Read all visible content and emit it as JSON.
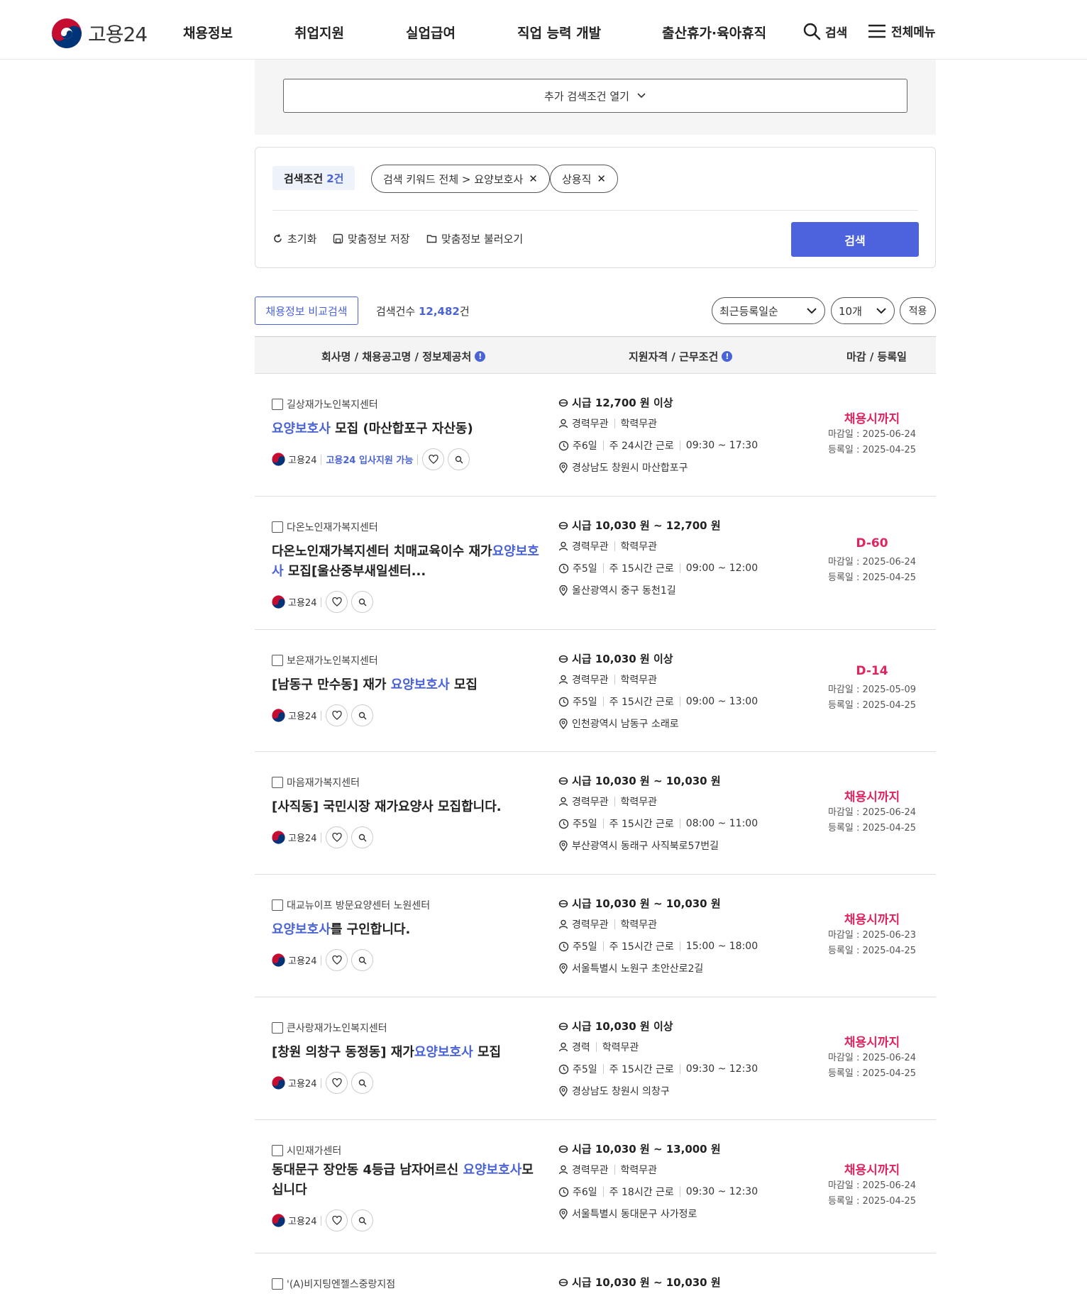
{
  "header": {
    "logo_text": "고용24",
    "nav": [
      "채용정보",
      "취업지원",
      "실업급여",
      "직업 능력 개발",
      "출산휴가·육아휴직"
    ],
    "search_label": "검색",
    "menu_label": "전체메뉴"
  },
  "options": {
    "more_conditions": "추가 검색조건 열기"
  },
  "conditions": {
    "label": "검색조건",
    "count": "2건",
    "chips": [
      "검색 키워드 전체 > 요양보호사",
      "상용직"
    ],
    "reset": "초기화",
    "save": "맞춤정보 저장",
    "load": "맞춤정보 불러오기",
    "search_button": "검색"
  },
  "toolbar": {
    "compare_button": "채용정보 비교검색",
    "total_label": "검색건수",
    "total_count": "12,482",
    "total_unit": "건",
    "sort_value": "최근등록일순",
    "size_value": "10개",
    "apply": "적용"
  },
  "table_header": {
    "col1": "회사명 / 채용공고명 / 정보제공처",
    "col2": "지원자격 / 근무조건",
    "col3": "마감 / 등록일"
  },
  "source_label": "고용24",
  "jobs": [
    {
      "company": "길상재가노인복지센터",
      "title_parts": [
        [
          "요양보호사",
          true
        ],
        [
          " 모집 (마산합포구 자산동)",
          false
        ]
      ],
      "apply_tag": "고용24 입사지원 가능",
      "wage": "시급 12,700 원 이상",
      "career": "경력무관",
      "edu": "학력무관",
      "days": "주6일",
      "hours": "주 24시간 근로",
      "time": "09:30 ~ 17:30",
      "location": "경상남도 창원시 마산합포구",
      "status": "채용시까지",
      "deadline": "마감일 : 2025-06-24",
      "registered": "등록일 : 2025-04-25"
    },
    {
      "company": "다온노인재가복지센터",
      "title_parts": [
        [
          "다온노인재가복지센터 치매교육이수 재가",
          false
        ],
        [
          "요양보호사",
          true
        ],
        [
          " 모집[울산중부새일센터...",
          false
        ]
      ],
      "apply_tag": "",
      "wage": "시급 10,030 원 ~ 12,700 원",
      "career": "경력무관",
      "edu": "학력무관",
      "days": "주5일",
      "hours": "주 15시간 근로",
      "time": "09:00 ~ 12:00",
      "location": "울산광역시 중구 동천1길",
      "status": "D-60",
      "deadline": "마감일 : 2025-06-24",
      "registered": "등록일 : 2025-04-25"
    },
    {
      "company": "보은재가노인복지센터",
      "title_parts": [
        [
          "[남동구 만수동] 재가 ",
          false
        ],
        [
          "요양보호사",
          true
        ],
        [
          " 모집",
          false
        ]
      ],
      "apply_tag": "",
      "wage": "시급 10,030 원 이상",
      "career": "경력무관",
      "edu": "학력무관",
      "days": "주5일",
      "hours": "주 15시간 근로",
      "time": "09:00 ~ 13:00",
      "location": "인천광역시 남동구 소래로",
      "status": "D-14",
      "deadline": "마감일 : 2025-05-09",
      "registered": "등록일 : 2025-04-25"
    },
    {
      "company": "마음재가복지센터",
      "title_parts": [
        [
          "[사직동] 국민시장 재가요양사 모집합니다.",
          false
        ]
      ],
      "apply_tag": "",
      "wage": "시급 10,030 원 ~ 10,030 원",
      "career": "경력무관",
      "edu": "학력무관",
      "days": "주5일",
      "hours": "주 15시간 근로",
      "time": "08:00 ~ 11:00",
      "location": "부산광역시 동래구 사직북로57번길",
      "status": "채용시까지",
      "deadline": "마감일 : 2025-06-24",
      "registered": "등록일 : 2025-04-25"
    },
    {
      "company": "대교뉴이프 방문요양센터 노원센터",
      "title_parts": [
        [
          "요양보호사",
          true
        ],
        [
          "를 구인합니다.",
          false
        ]
      ],
      "apply_tag": "",
      "wage": "시급 10,030 원 ~ 10,030 원",
      "career": "경력무관",
      "edu": "학력무관",
      "days": "주5일",
      "hours": "주 15시간 근로",
      "time": "15:00 ~ 18:00",
      "location": "서울특별시 노원구 초안산로2길",
      "status": "채용시까지",
      "deadline": "마감일 : 2025-06-23",
      "registered": "등록일 : 2025-04-25"
    },
    {
      "company": "큰사랑재가노인복지센터",
      "title_parts": [
        [
          "[창원 의창구 동정동] 재가",
          false
        ],
        [
          "요양보호사",
          true
        ],
        [
          " 모집",
          false
        ]
      ],
      "apply_tag": "",
      "wage": "시급 10,030 원 이상",
      "career": "경력",
      "edu": "학력무관",
      "days": "주5일",
      "hours": "주 15시간 근로",
      "time": "09:30 ~ 12:30",
      "location": "경상남도 창원시 의창구",
      "status": "채용시까지",
      "deadline": "마감일 : 2025-06-24",
      "registered": "등록일 : 2025-04-25"
    },
    {
      "company": "시민재가센터",
      "title_parts": [
        [
          "동대문구 장안동 4등급 남자어르신 ",
          false
        ],
        [
          "요양보호사",
          true
        ],
        [
          "모십니다",
          false
        ]
      ],
      "apply_tag": "",
      "wage": "시급 10,030 원 ~ 13,000 원",
      "career": "경력무관",
      "edu": "학력무관",
      "days": "주6일",
      "hours": "주 18시간 근로",
      "time": "09:30 ~ 12:30",
      "location": "서울특별시 동대문구 사가정로",
      "status": "채용시까지",
      "deadline": "마감일 : 2025-06-24",
      "registered": "등록일 : 2025-04-25"
    },
    {
      "company": "'(A)비지팅엔젤스중랑지점",
      "title_parts": [],
      "apply_tag": "",
      "wage": "시급 10,030 원 ~ 10,030 원",
      "career": "",
      "edu": "",
      "days": "",
      "hours": "",
      "time": "",
      "location": "",
      "status": "",
      "deadline": "",
      "registered": ""
    }
  ],
  "colors": {
    "accent": "#4a63d6",
    "search_button": "#4d63dd",
    "status": "#e0245e"
  }
}
